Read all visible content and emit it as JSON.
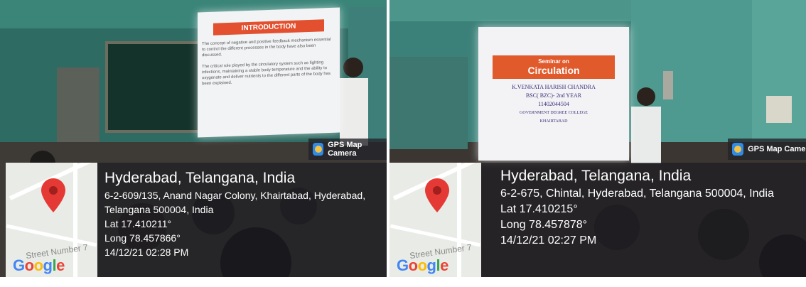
{
  "badge": {
    "label": "GPS Map Camera"
  },
  "map": {
    "street": "Street Number 7",
    "logo": "Google"
  },
  "photos": [
    {
      "location_title": "Hyderabad, Telangana, India",
      "address": "6-2-609/135, Anand Nagar Colony, Khairtabad, Hyderabad,",
      "address_cont": "Telangana 500004, India",
      "lat": "Lat 17.410211°",
      "long": "Long 78.457866°",
      "datetime": "14/12/21 02:28 PM",
      "slide": {
        "title": "INTRODUCTION",
        "para1": "The concept of negative and positive feedback mechanism essential to control the different processes in the body have also been discussed.",
        "para2": "The critical role played by the circulatory system such as fighting infections, maintaining a stable body temperature and the ability to oxygenate and deliver nutrients to the different parts of the body has been explained."
      }
    },
    {
      "location_title": "Hyderabad, Telangana, India",
      "address": "6-2-675, Chintal, Hyderabad, Telangana 500004, India",
      "lat": "Lat 17.410215°",
      "long": "Long 78.457878°",
      "datetime": "14/12/21 02:27 PM",
      "slide": {
        "title_small": "Seminar on",
        "title": "Circulation",
        "name": "K.VENKATA HARISH CHANDRA",
        "course": "BSC( BZC)- 2nd YEAR",
        "roll": "11402044504",
        "college": "GOVERNMENT DEGREE COLLEGE",
        "place": "KHAIRTABAD"
      }
    }
  ],
  "colors": {
    "overlay": "#19191e",
    "pin": "#e53935",
    "badge_icon": "#2e8be8"
  }
}
